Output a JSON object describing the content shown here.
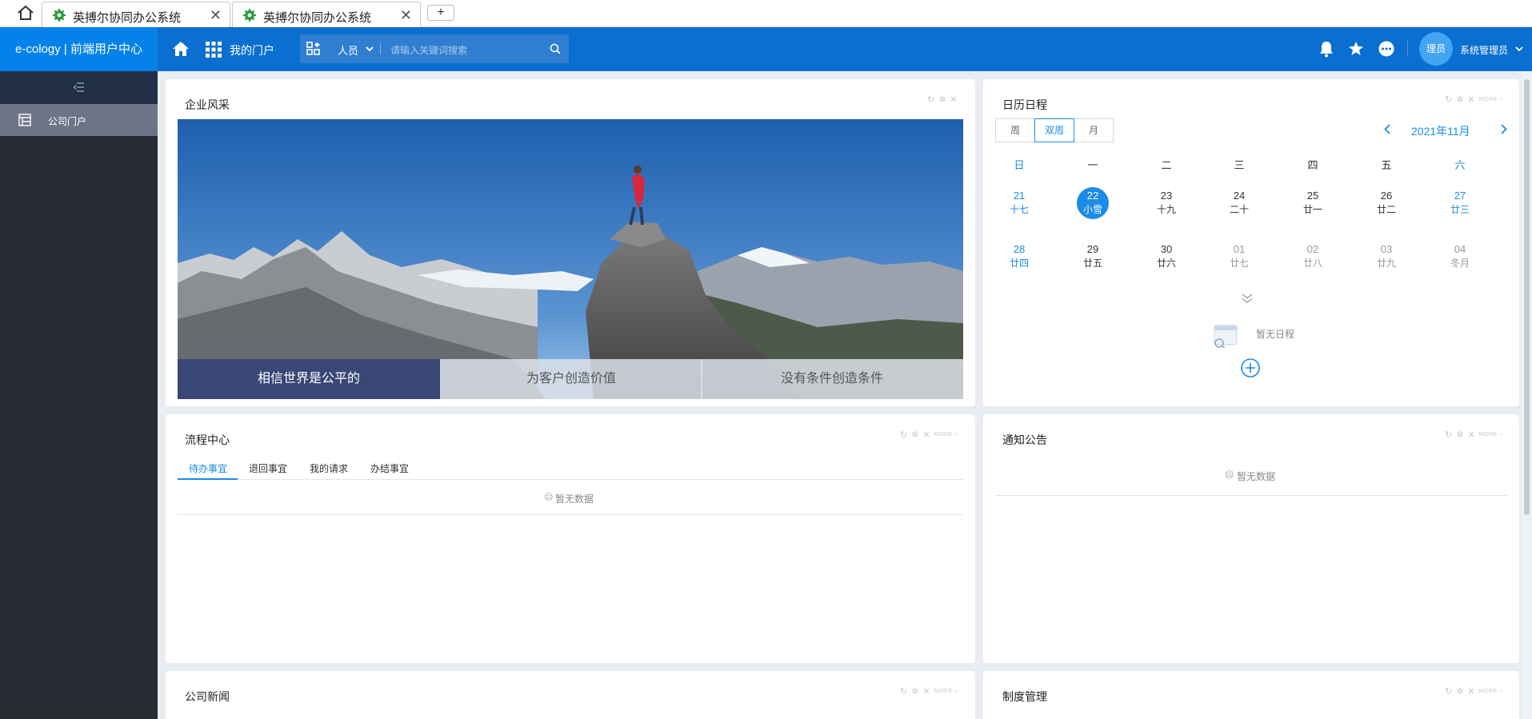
{
  "browser": {
    "tabs": [
      {
        "title": "英搏尔协同办公系统",
        "close": "✕"
      },
      {
        "title": "英搏尔协同办公系统",
        "close": "✕"
      }
    ],
    "new_tab": "+"
  },
  "header": {
    "brand": "e-cology | 前端用户中心",
    "my_portal": "我的门户",
    "search_scope": "人员",
    "search_placeholder": "请输入关键词搜索",
    "avatar_text": "理员",
    "username": "系统管理员"
  },
  "sidebar": {
    "items": [
      {
        "label": "公司门户"
      }
    ]
  },
  "panels": {
    "culture": {
      "title": "企业风采",
      "captions": [
        "相信世界是公平的",
        "为客户创造价值",
        "没有条件创造条件"
      ]
    },
    "calendar": {
      "title": "日历日程",
      "more": "MORE ››",
      "views": [
        "周",
        "双周",
        "月"
      ],
      "active_view": "双周",
      "month": "2021年11月",
      "weekdays": [
        "日",
        "一",
        "二",
        "三",
        "四",
        "五",
        "六"
      ],
      "week1": [
        {
          "d": "21",
          "l": "十七"
        },
        {
          "d": "22",
          "l": "小雪"
        },
        {
          "d": "23",
          "l": "十九"
        },
        {
          "d": "24",
          "l": "二十"
        },
        {
          "d": "25",
          "l": "廿一"
        },
        {
          "d": "26",
          "l": "廿二"
        },
        {
          "d": "27",
          "l": "廿三"
        }
      ],
      "week2": [
        {
          "d": "28",
          "l": "廿四"
        },
        {
          "d": "29",
          "l": "廿五"
        },
        {
          "d": "30",
          "l": "廿六"
        },
        {
          "d": "01",
          "l": "廿七"
        },
        {
          "d": "02",
          "l": "廿八"
        },
        {
          "d": "03",
          "l": "廿九"
        },
        {
          "d": "04",
          "l": "冬月"
        }
      ],
      "empty": "暂无日程"
    },
    "workflow": {
      "title": "流程中心",
      "more": "MORE ››",
      "tabs": [
        "待办事宜",
        "退回事宜",
        "我的请求",
        "办结事宜"
      ],
      "empty": "暂无数据"
    },
    "notice": {
      "title": "通知公告",
      "more": "MORE ››",
      "empty": "暂无数据"
    },
    "news": {
      "title": "公司新闻",
      "more": "MORE ››"
    },
    "policy": {
      "title": "制度管理",
      "more": "MORE ››"
    }
  },
  "colors": {
    "header": "#0a6fd0",
    "brand": "#0582ea",
    "accent": "#1a8ce6",
    "sidebar": "#272b36"
  }
}
